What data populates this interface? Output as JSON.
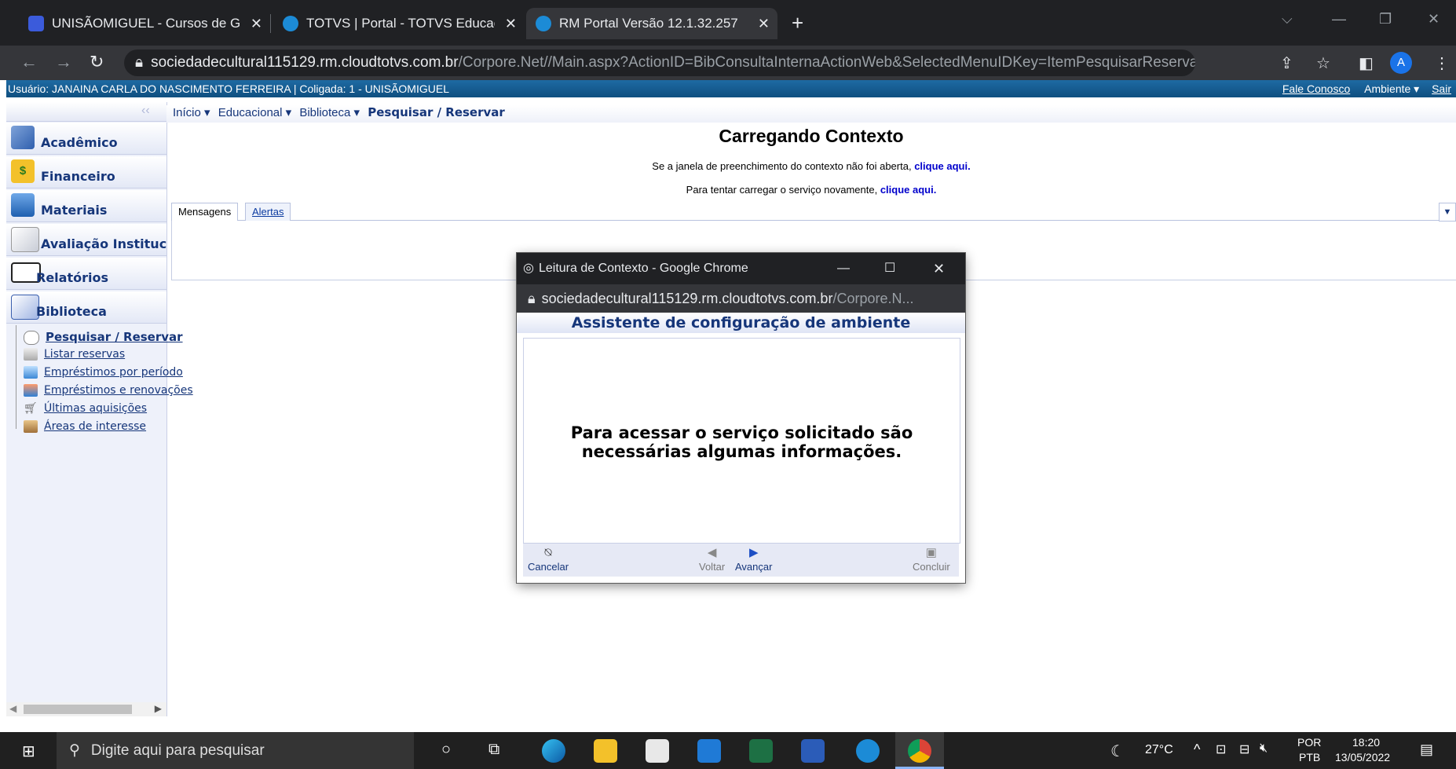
{
  "browser": {
    "tabs": [
      {
        "title": "UNISÃOMIGUEL - Cursos de Grad",
        "favicon_color": "#3b5bdb",
        "active": false
      },
      {
        "title": "TOTVS | Portal - TOTVS Educacion",
        "favicon_color": "#1c8bd6",
        "active": false
      },
      {
        "title": "RM Portal Versão 12.1.32.257",
        "favicon_color": "#1c8bd6",
        "active": true
      }
    ],
    "new_tab_label": "+",
    "url_host": "sociedadecultural115129.rm.cloudtotvs.com.br",
    "url_path": "/Corpore.Net//Main.aspx?ActionID=BibConsultaInternaActionWeb&SelectedMenuIDKey=ItemPesquisarReservar",
    "avatar_letter": "A"
  },
  "app_header": {
    "user_text": "Usuário: JANAINA CARLA DO NASCIMENTO FERREIRA  |  Coligada: 1 - UNISÃOMIGUEL",
    "links": [
      "Fale Conosco",
      "Ambiente ▾",
      "Sair"
    ]
  },
  "sidebar": {
    "sections": [
      {
        "label": "Acadêmico",
        "icon": "academic-icon"
      },
      {
        "label": "Financeiro",
        "icon": "finance-icon"
      },
      {
        "label": "Materiais",
        "icon": "materials-icon"
      },
      {
        "label": "Avaliação Institucional",
        "icon": "evaluation-icon"
      },
      {
        "label": "Relatórios",
        "icon": "reports-icon"
      },
      {
        "label": "Biblioteca",
        "icon": "library-icon"
      }
    ],
    "library_items": [
      {
        "label": "Pesquisar / Reservar",
        "active": true
      },
      {
        "label": "Listar reservas"
      },
      {
        "label": "Empréstimos por período"
      },
      {
        "label": "Empréstimos e renovações"
      },
      {
        "label": "Últimas aquisições"
      },
      {
        "label": "Áreas de interesse"
      }
    ],
    "collapse_glyph": "‹‹"
  },
  "breadcrumb": {
    "items": [
      "Início ▾",
      "Educacional ▾",
      "Biblioteca ▾"
    ],
    "current": "Pesquisar / Reservar"
  },
  "main": {
    "title": "Carregando Contexto",
    "line1_text": "Se a janela de preenchimento do contexto não foi aberta,",
    "line1_link": "clique aqui.",
    "line2_text": "Para tentar carregar o serviço novamente,",
    "line2_link": "clique aqui.",
    "tabs": [
      "Mensagens",
      "Alertas"
    ]
  },
  "popup": {
    "window_title": "Leitura de Contexto - Google Chrome",
    "url_host": "sociedadecultural115129.rm.cloudtotvs.com.br",
    "url_path": "/Corpore.N...",
    "wizard_title": "Assistente de configuração de ambiente",
    "message_line1": "Para acessar o serviço solicitado são",
    "message_line2": "necessárias algumas informações.",
    "buttons": {
      "cancel": "Cancelar",
      "back": "Voltar",
      "next": "Avançar",
      "finish": "Concluir"
    }
  },
  "taskbar": {
    "search_placeholder": "Digite aqui para pesquisar",
    "weather": "27°C",
    "lang_top": "POR",
    "lang_bottom": "PTB",
    "time": "18:20",
    "date": "13/05/2022"
  }
}
